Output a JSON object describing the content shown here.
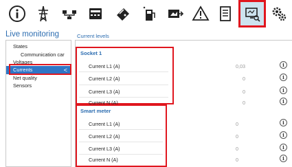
{
  "toolbar": {
    "icons": [
      "info-icon",
      "power-tower-icon",
      "network-icon",
      "device-icon",
      "payment-card-icon",
      "charger-icon",
      "camera-arrow-icon",
      "warning-icon",
      "document-icon",
      "monitor-icon",
      "settings-gears-icon"
    ],
    "active_icon": "monitor-icon"
  },
  "sidebar": {
    "title": "Live monitoring",
    "items": [
      {
        "label": "States"
      },
      {
        "label": "Communication car"
      },
      {
        "label": "Voltages"
      },
      {
        "label": "Currents",
        "chevron": "<"
      },
      {
        "label": "Net quality"
      },
      {
        "label": "Sensors"
      }
    ],
    "selected": "Currents"
  },
  "main": {
    "title": "Current levels",
    "groups": [
      {
        "title": "Socket 1",
        "rows": [
          {
            "label": "Current L1 (A)",
            "value": "0,03",
            "info": "i"
          },
          {
            "label": "Current L2 (A)",
            "value": "0",
            "info": "i"
          },
          {
            "label": "Current L3 (A)",
            "value": "0",
            "info": "i"
          },
          {
            "label": "Current N (A)",
            "value": "0",
            "info": "i"
          }
        ]
      },
      {
        "title": "Smart meter",
        "rows": [
          {
            "label": "Current L1 (A)",
            "value": "0",
            "info": "i"
          },
          {
            "label": "Current L2 (A)",
            "value": "0",
            "info": "i"
          },
          {
            "label": "Current L3 (A)",
            "value": "0",
            "info": "i"
          },
          {
            "label": "Current N (A)",
            "value": "0",
            "info": "i"
          }
        ]
      }
    ]
  },
  "colors": {
    "accent": "#2b6cb0",
    "selection": "#2f76c6",
    "highlight": "#e0161e"
  }
}
